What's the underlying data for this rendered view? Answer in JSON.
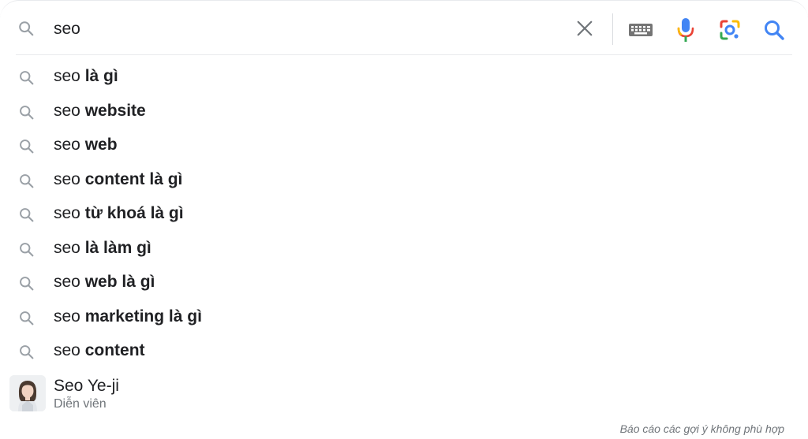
{
  "search": {
    "query": "seo"
  },
  "suggestions": [
    {
      "prefix": "seo",
      "completion": "là gì"
    },
    {
      "prefix": "seo",
      "completion": "website"
    },
    {
      "prefix": "seo",
      "completion": "web"
    },
    {
      "prefix": "seo",
      "completion": "content là gì"
    },
    {
      "prefix": "seo",
      "completion": "từ khoá là gì"
    },
    {
      "prefix": "seo",
      "completion": "là làm gì"
    },
    {
      "prefix": "seo",
      "completion": "web là gì"
    },
    {
      "prefix": "seo",
      "completion": "marketing là gì"
    },
    {
      "prefix": "seo",
      "completion": "content"
    }
  ],
  "entity": {
    "title": "Seo Ye-ji",
    "subtitle": "Diễn viên"
  },
  "footer": {
    "report_link": "Báo cáo các gợi ý không phù hợp"
  },
  "icons": {
    "search": "search-icon",
    "clear": "close-icon",
    "keyboard": "keyboard-icon",
    "mic": "microphone-icon",
    "lens": "google-lens-icon"
  },
  "colors": {
    "text": "#202124",
    "secondary_text": "#70757a",
    "icon_gray": "#9aa0a6",
    "google_blue": "#4285f4",
    "google_red": "#ea4335",
    "google_yellow": "#fbbc04",
    "google_green": "#34a853"
  }
}
